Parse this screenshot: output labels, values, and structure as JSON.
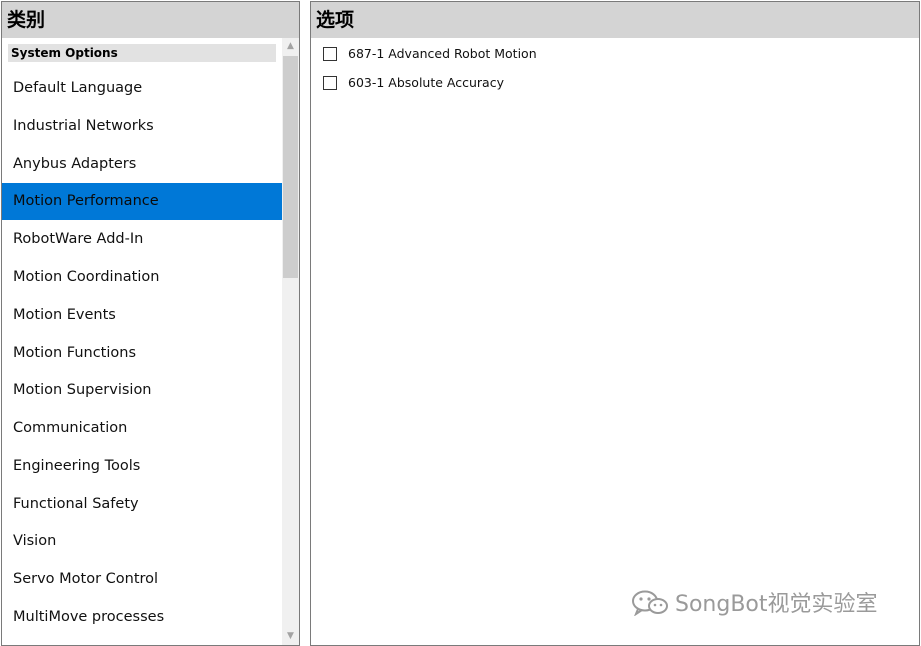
{
  "category_panel": {
    "title": "类别",
    "group_header": "System Options",
    "items": [
      {
        "label": "Default Language",
        "selected": false
      },
      {
        "label": "Industrial Networks",
        "selected": false
      },
      {
        "label": "Anybus Adapters",
        "selected": false
      },
      {
        "label": "Motion Performance",
        "selected": true
      },
      {
        "label": "RobotWare Add-In",
        "selected": false
      },
      {
        "label": "Motion Coordination",
        "selected": false
      },
      {
        "label": "Motion Events",
        "selected": false
      },
      {
        "label": "Motion Functions",
        "selected": false
      },
      {
        "label": "Motion Supervision",
        "selected": false
      },
      {
        "label": "Communication",
        "selected": false
      },
      {
        "label": "Engineering Tools",
        "selected": false
      },
      {
        "label": "Functional Safety",
        "selected": false
      },
      {
        "label": "Vision",
        "selected": false
      },
      {
        "label": "Servo Motor Control",
        "selected": false
      },
      {
        "label": "MultiMove processes",
        "selected": false
      }
    ]
  },
  "options_panel": {
    "title": "选项",
    "options": [
      {
        "label": "687-1 Advanced Robot Motion",
        "checked": false
      },
      {
        "label": "603-1 Absolute Accuracy",
        "checked": false
      }
    ]
  },
  "watermark": {
    "text": "SongBot视觉实验室",
    "icon": "wechat-icon"
  },
  "colors": {
    "header_bg": "#d4d4d4",
    "selection": "#0078d7",
    "watermark": "#9a9a9a"
  }
}
